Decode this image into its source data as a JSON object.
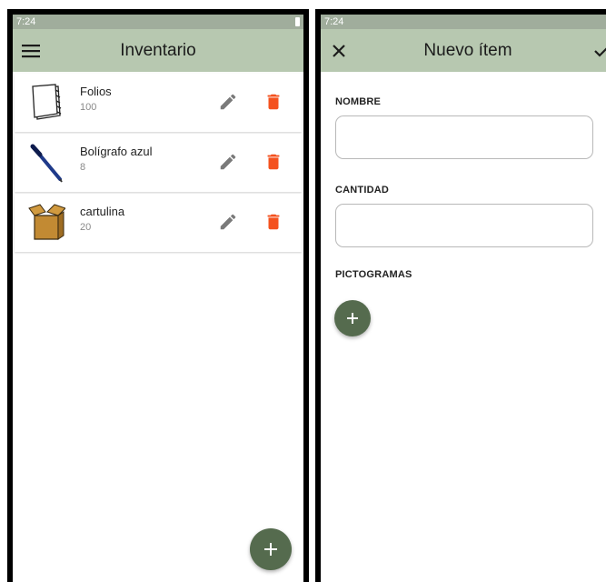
{
  "left_screen": {
    "status_time": "7:24",
    "title": "Inventario",
    "items": [
      {
        "name": "Folios",
        "qty": "100",
        "icon": "paper-stack-icon"
      },
      {
        "name": "Bolígrafo azul",
        "qty": "8",
        "icon": "pen-icon"
      },
      {
        "name": "cartulina",
        "qty": "20",
        "icon": "cardboard-box-icon"
      }
    ],
    "fab_icon": "plus"
  },
  "right_screen": {
    "status_time": "7:24",
    "title": "Nuevo ítem",
    "nombre_label": "NOMBRE",
    "nombre_value": "",
    "cantidad_label": "CANTIDAD",
    "cantidad_value": "",
    "pictogramas_label": "PICTOGRAMAS"
  },
  "colors": {
    "appbar": "#b7c8b0",
    "statusbar": "#a0ad9c",
    "fab": "#556b4e",
    "delete": "#f4511e",
    "edit": "#7a7a7a"
  }
}
